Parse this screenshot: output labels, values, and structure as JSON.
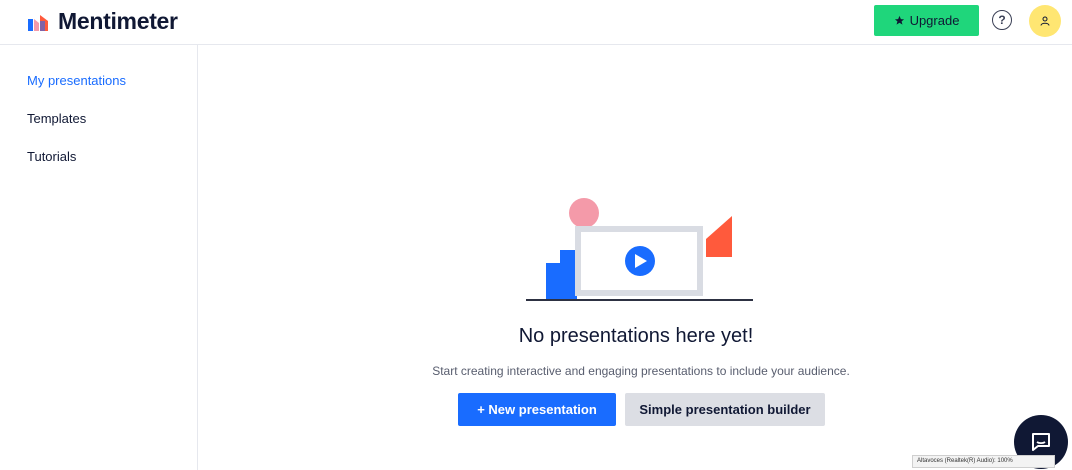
{
  "header": {
    "brand_name": "Mentimeter",
    "upgrade_label": "Upgrade",
    "help_symbol": "?",
    "icons": {
      "logo": "mentimeter-logo-icon",
      "upgrade": "star-icon",
      "help": "question-circle-icon",
      "avatar": "user-icon"
    }
  },
  "sidebar": {
    "items": [
      {
        "label": "My presentations",
        "active": true
      },
      {
        "label": "Templates",
        "active": false
      },
      {
        "label": "Tutorials",
        "active": false
      }
    ]
  },
  "main": {
    "empty_title": "No presentations here yet!",
    "empty_subtitle": "Start creating interactive and engaging presentations to include your audience.",
    "new_presentation_label": "+ New presentation",
    "simple_builder_label": "Simple presentation builder",
    "illustration_icon": "presentation-play-illustration"
  },
  "chat": {
    "icon": "chat-bubble-icon"
  },
  "system_tooltip": {
    "text": "Altavoces (Realtek(R) Audio): 100%"
  },
  "colors": {
    "brand_blue": "#196cff",
    "upgrade_green": "#1fd67b",
    "avatar_yellow": "#ffe672",
    "secondary_gray": "#dcdee4",
    "dark_navy": "#101834",
    "accent_coral": "#ff5a3c",
    "accent_pink": "#f49aa9"
  }
}
